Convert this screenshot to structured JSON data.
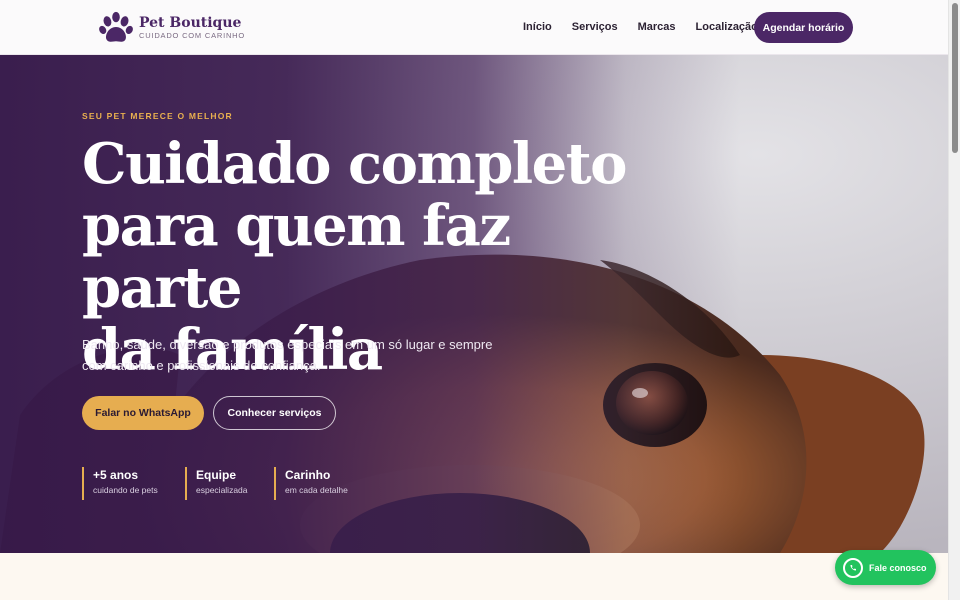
{
  "header": {
    "brand_name": "Pet Boutique",
    "brand_tagline": "CUIDADO COM CARINHO",
    "nav": [
      "Início",
      "Serviços",
      "Marcas",
      "Localização"
    ],
    "cta_label": "Agendar horário"
  },
  "hero": {
    "eyebrow": "SEU PET MERECE O MELHOR",
    "title_lines": [
      "Cuidado completo",
      "para quem faz parte",
      "da família"
    ],
    "description": "Banho, saúde, diversão e produtos especiais em um só lugar e sempre com carinho e profissionais de confiança.",
    "primary_button": "Falar no WhatsApp",
    "secondary_button": "Conhecer serviços",
    "stats": [
      {
        "title": "+5 anos",
        "subtitle": "cuidando de pets"
      },
      {
        "title": "Equipe",
        "subtitle": "especializada"
      },
      {
        "title": "Carinho",
        "subtitle": "em cada detalhe"
      }
    ]
  },
  "floating_contact": {
    "label": "Fale conosco",
    "icon": "whatsapp-icon"
  },
  "colors": {
    "brand_purple": "#4b2766",
    "accent_gold": "#e6ad50",
    "whatsapp_green": "#22c35e"
  }
}
